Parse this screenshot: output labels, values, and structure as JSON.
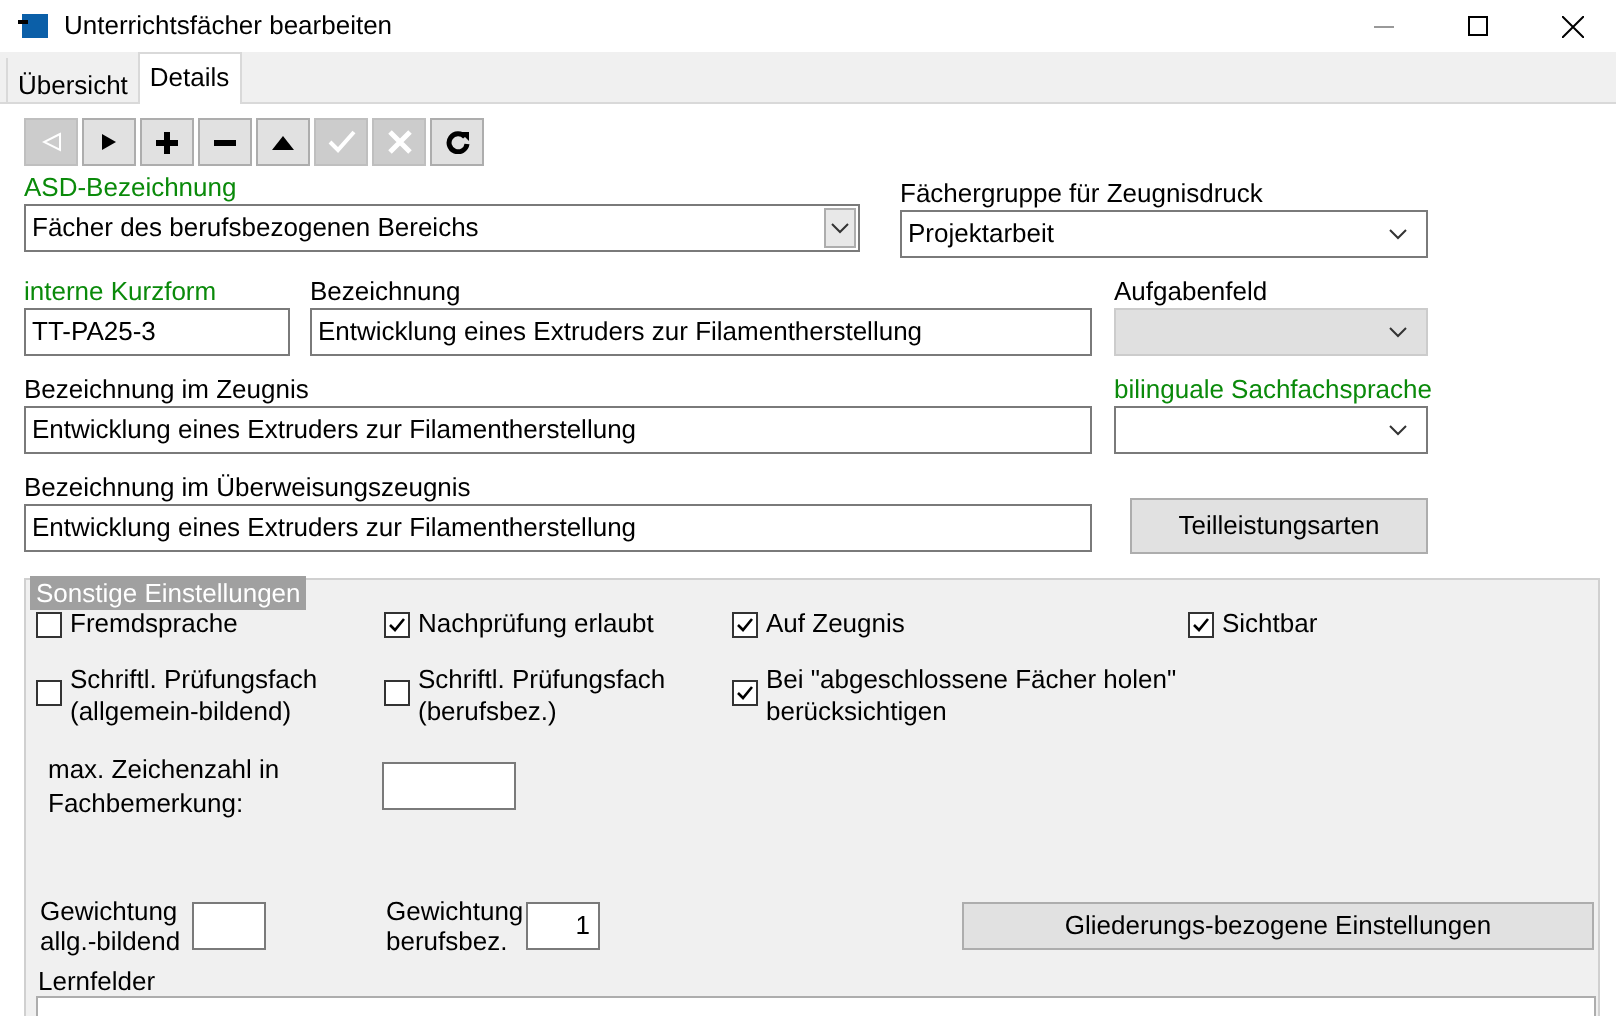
{
  "window": {
    "title": "Unterrichtsfächer bearbeiten"
  },
  "tabs": [
    {
      "label": "Übersicht",
      "selected": false
    },
    {
      "label": "Details",
      "selected": true
    }
  ],
  "toolbar": [
    {
      "kind": "first",
      "disabled": true
    },
    {
      "kind": "next",
      "disabled": false
    },
    {
      "kind": "add",
      "disabled": false
    },
    {
      "kind": "remove",
      "disabled": false
    },
    {
      "kind": "up",
      "disabled": false
    },
    {
      "kind": "save",
      "disabled": true
    },
    {
      "kind": "cancel",
      "disabled": true
    },
    {
      "kind": "refresh",
      "disabled": false
    }
  ],
  "asd": {
    "label": "ASD-Bezeichnung",
    "value": "Fächer des berufsbezogenen Bereichs"
  },
  "faechergruppe": {
    "label": "Fächergruppe für Zeugnisdruck",
    "value": "Projektarbeit"
  },
  "kurzform": {
    "label": "interne Kurzform",
    "value": "TT-PA25-3"
  },
  "bezeichnung": {
    "label": "Bezeichnung",
    "value": "Entwicklung eines Extruders zur Filamentherstellung"
  },
  "aufgabenfeld": {
    "label": "Aufgabenfeld",
    "disabled": true
  },
  "zeugnis": {
    "label": "Bezeichnung im Zeugnis",
    "value": "Entwicklung eines Extruders zur Filamentherstellung"
  },
  "bilingual": {
    "label": "bilinguale Sachfachsprache",
    "disabled": false
  },
  "ueberweisung": {
    "label": "Bezeichnung im Überweisungszeugnis",
    "value": "Entwicklung eines Extruders zur Filamentherstellung"
  },
  "teilleistung_button": "Teilleistungsarten",
  "settings": {
    "title": "Sonstige Einstellungen",
    "checkboxes": [
      {
        "label": "Fremdsprache",
        "checked": false
      },
      {
        "label": "Nachprüfung erlaubt",
        "checked": true
      },
      {
        "label": "Auf Zeugnis",
        "checked": true
      },
      {
        "label": "Sichtbar",
        "checked": true
      },
      {
        "label": "Schriftl. Prüfungsfach (allgemein-bildend)",
        "checked": false
      },
      {
        "label": "Schriftl. Prüfungsfach (berufsbez.)",
        "checked": false
      },
      {
        "label": "Bei \"abgeschlossene Fächer holen\" berücksichtigen",
        "checked": true
      }
    ],
    "max_chars": {
      "label": "max. Zeichenzahl in Fachbemerkung:"
    },
    "weight_general": {
      "label": "Gewichtung allg.-bildend"
    },
    "weight_vocational": {
      "label": "Gewichtung berufsbez.",
      "value": "1"
    },
    "gliederung_button": "Gliederungs-bezogene Einstellungen",
    "lernfelder": {
      "label": "Lernfelder"
    }
  }
}
